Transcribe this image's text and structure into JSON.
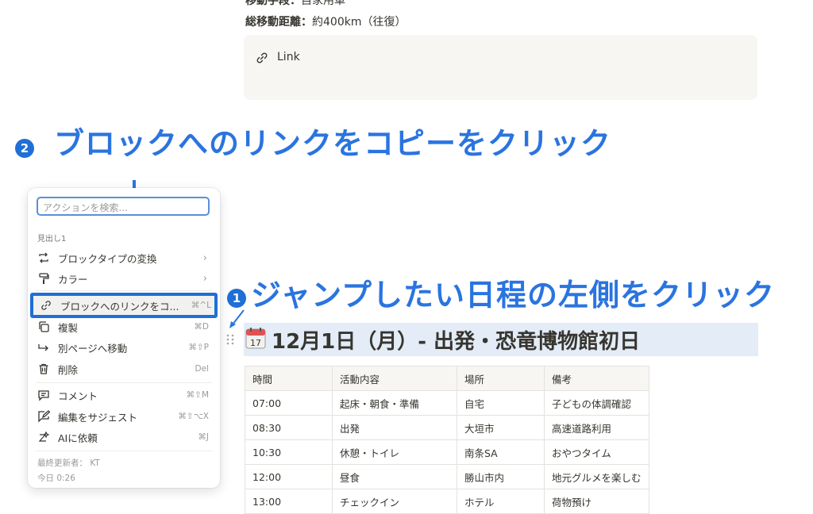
{
  "top": {
    "line1_label": "移動手段：",
    "line1_value": "自家用車",
    "line2_label": "総移動距離：",
    "line2_value": "約400km（往復）",
    "link_text": "Link"
  },
  "annotations": {
    "step2_num": "2",
    "step2_text": "ブロックへのリンクをコピーをクリック",
    "step1_num": "1",
    "step1_text": "ジャンプしたい日程の左側をクリック",
    "accent_color": "#2a74e0"
  },
  "menu": {
    "search_placeholder": "アクションを検索...",
    "section_label": "見出し1",
    "items": [
      {
        "label": "ブロックタイプの変換",
        "shortcut": "",
        "icon": "turn-into-icon",
        "chevron": "›"
      },
      {
        "label": "カラー",
        "shortcut": "",
        "icon": "paint-roller-icon",
        "chevron": "›"
      },
      {
        "label": "ブロックへのリンクをコ...",
        "shortcut": "⌘^L",
        "icon": "link-icon",
        "chevron": ""
      },
      {
        "label": "複製",
        "shortcut": "⌘D",
        "icon": "duplicate-icon",
        "chevron": ""
      },
      {
        "label": "別ページへ移動",
        "shortcut": "⌘⇧P",
        "icon": "move-to-icon",
        "chevron": ""
      },
      {
        "label": "削除",
        "shortcut": "Del",
        "icon": "trash-icon",
        "chevron": ""
      },
      {
        "label": "コメント",
        "shortcut": "⌘⇧M",
        "icon": "comment-icon",
        "chevron": ""
      },
      {
        "label": "編集をサジェスト",
        "shortcut": "⌘⇧⌥X",
        "icon": "suggest-edit-icon",
        "chevron": ""
      },
      {
        "label": "AIに依頼",
        "shortcut": "⌘J",
        "icon": "ai-icon",
        "chevron": ""
      }
    ],
    "footer_editor": "最終更新者： KT",
    "footer_time": "今日 0:26"
  },
  "heading": {
    "calendar_icon_day": "17",
    "text": "12月1日（月）- 出発・恐竜博物館初日"
  },
  "table": {
    "headers": [
      "時間",
      "活動内容",
      "場所",
      "備考"
    ],
    "rows": [
      [
        "07:00",
        "起床・朝食・準備",
        "自宅",
        "子どもの体調確認"
      ],
      [
        "08:30",
        "出発",
        "大垣市",
        "高速道路利用"
      ],
      [
        "10:30",
        "休憩・トイレ",
        "南条SA",
        "おやつタイム"
      ],
      [
        "12:00",
        "昼食",
        "勝山市内",
        "地元グルメを楽しむ"
      ],
      [
        "13:00",
        "チェックイン",
        "ホテル",
        "荷物預け"
      ]
    ]
  }
}
